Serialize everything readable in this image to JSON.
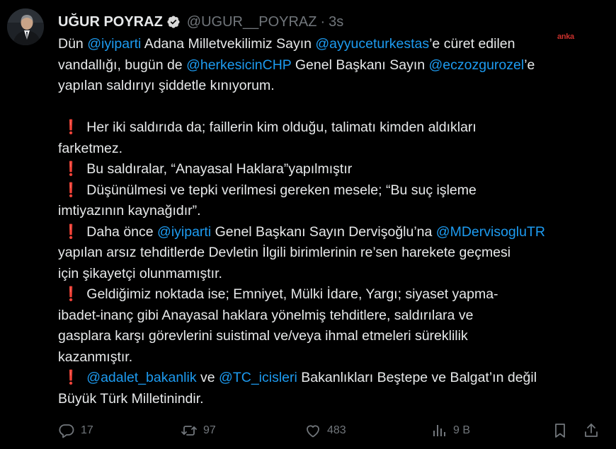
{
  "author": {
    "display_name": "UĞUR POYRAZ",
    "handle": "@UGUR__POYRAZ",
    "separator": "·",
    "time": "3s",
    "verified_icon": "verified-badge-icon",
    "avatar": "profile-photo"
  },
  "watermark": "anka",
  "tweet": {
    "l1_a": "Dün ",
    "l1_m1": "@iyiparti",
    "l1_b": " Adana Milletvekilimiz Sayın ",
    "l1_m2": "@ayyuceturkestas",
    "l1_c": "’e cüret edilen",
    "l2_a": "vandallığı, bugün de ",
    "l2_m1": "@herkesicinCHP",
    "l2_b": " Genel Başkanı Sayın ",
    "l2_m2": "@eczozgurozel",
    "l2_c": "’e",
    "l3": "yapılan saldırıyı şiddetle kınıyorum.",
    "bang": "❗",
    "p1_l1": "Her iki saldırıda da; faillerin kim olduğu, talimatı kimden aldıkları",
    "p1_l2": "farketmez.",
    "p2_l1": "Bu saldıralar, “Anayasal Haklara”yapılmıştır",
    "p3_l1": "Düşünülmesi ve tepki verilmesi gereken mesele; “Bu suç işleme",
    "p3_l2": "imtiyazının kaynağıdır”.",
    "p4_a": "Daha önce ",
    "p4_m1": "@iyiparti",
    "p4_b": " Genel Başkanı Sayın Dervişoğlu’na ",
    "p4_m2": "@MDervisogluTR",
    "p4_l2": "yapılan arsız tehditlerde Devletin İlgili birimlerinin re’sen harekete geçmesi",
    "p4_l3": "için şikayetçi olunmamıştır.",
    "p5_l1": "Geldiğimiz noktada ise; Emniyet, Mülki İdare, Yargı; siyaset yapma-",
    "p5_l2": "ibadet-inanç gibi Anayasal haklara yönelmiş tehditlere, saldırılara ve",
    "p5_l3": "gasplara karşı görevlerini suistimal ve/veya ihmal etmeleri süreklilik",
    "p5_l4": "kazanmıştır.",
    "p6_m1": "@adalet_bakanlik",
    "p6_a": " ve ",
    "p6_m2": "@TC_icisleri",
    "p6_b": " Bakanlıkları Beştepe ve Balgat’ın değil",
    "p6_l2": "Büyük Türk Milletinindir."
  },
  "actions": {
    "replies": "17",
    "reposts": "97",
    "likes": "483",
    "views": "9 B"
  },
  "colors": {
    "background": "#000000",
    "text": "#e7e9ea",
    "muted": "#71767b",
    "mention": "#1d9bf0",
    "exclamation": "#e0202c"
  }
}
